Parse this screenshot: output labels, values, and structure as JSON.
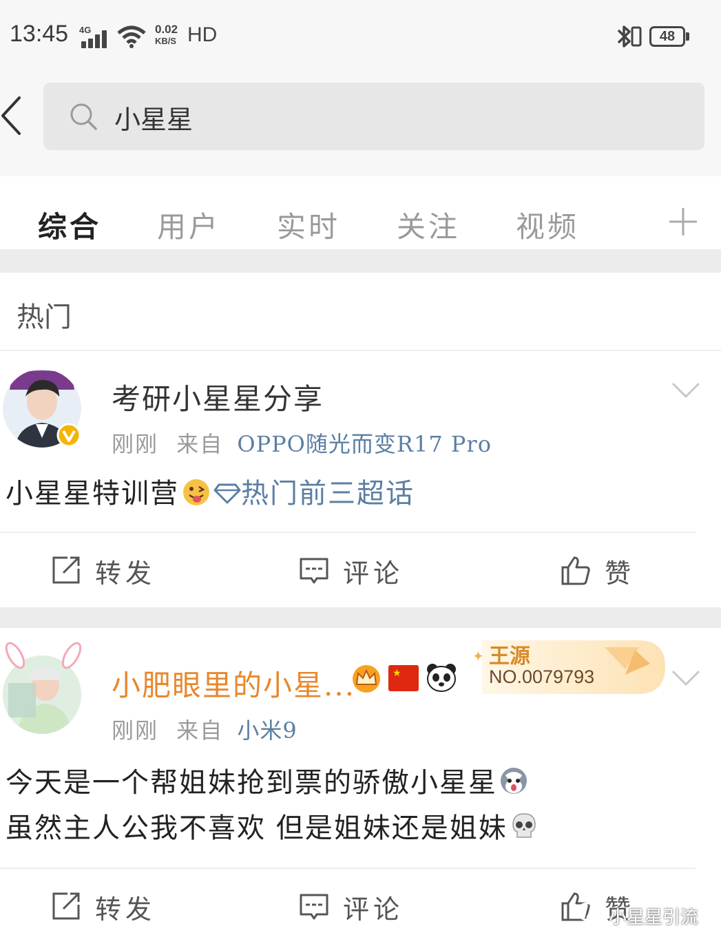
{
  "status_bar": {
    "time": "13:45",
    "network": "4G",
    "speed_value": "0.02",
    "speed_unit": "KB/S",
    "hd": "HD",
    "battery": "48"
  },
  "search": {
    "query": "小星星"
  },
  "tabs": [
    {
      "label": "综合",
      "active": true
    },
    {
      "label": "用户",
      "active": false
    },
    {
      "label": "实时",
      "active": false
    },
    {
      "label": "关注",
      "active": false
    },
    {
      "label": "视频",
      "active": false
    }
  ],
  "section_title": "热门",
  "posts": [
    {
      "username": "考研小星星分享",
      "time": "刚刚",
      "from_prefix": "来自",
      "source": "OPPO随光而变R17 Pro",
      "text_lines": [
        "小星星特训营"
      ],
      "topic_link": "热门前三超话",
      "actions": {
        "repost": "转发",
        "comment": "评论",
        "like": "赞"
      }
    },
    {
      "username": "小肥眼里的小星...",
      "time": "刚刚",
      "from_prefix": "来自",
      "source": "小米9",
      "badge_name": "王源",
      "badge_number": "NO.0079793",
      "text_lines": [
        "今天是一个帮姐妹抢到票的骄傲小星星",
        "虽然主人公我不喜欢 但是姐妹还是姐妹"
      ],
      "actions": {
        "repost": "转发",
        "comment": "评论",
        "like": "赞"
      }
    }
  ],
  "watermark": "小星星引流",
  "colors": {
    "link_blue": "#5b7ea3",
    "vip_orange": "#e8872b",
    "verified_gold": "#f5b400"
  }
}
